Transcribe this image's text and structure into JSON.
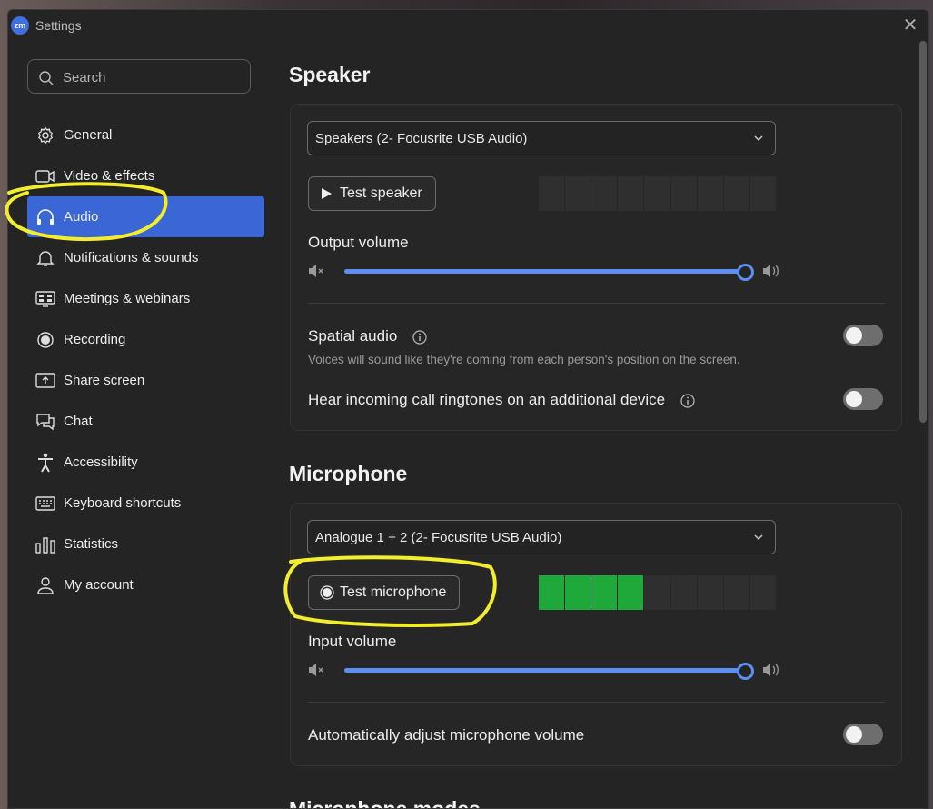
{
  "window": {
    "title": "Settings",
    "logo_text": "zm",
    "close_glyph": "✕"
  },
  "search": {
    "placeholder": "Search"
  },
  "sidebar": {
    "items": [
      {
        "label": "General",
        "icon": "gear-icon"
      },
      {
        "label": "Video & effects",
        "icon": "video-camera-icon"
      },
      {
        "label": "Audio",
        "icon": "headphones-icon",
        "active": true
      },
      {
        "label": "Notifications & sounds",
        "icon": "bell-icon"
      },
      {
        "label": "Meetings & webinars",
        "icon": "meetings-icon"
      },
      {
        "label": "Recording",
        "icon": "record-icon"
      },
      {
        "label": "Share screen",
        "icon": "share-screen-icon"
      },
      {
        "label": "Chat",
        "icon": "chat-icon"
      },
      {
        "label": "Accessibility",
        "icon": "accessibility-icon"
      },
      {
        "label": "Keyboard shortcuts",
        "icon": "keyboard-icon"
      },
      {
        "label": "Statistics",
        "icon": "statistics-icon"
      },
      {
        "label": "My account",
        "icon": "user-icon"
      }
    ]
  },
  "speaker": {
    "heading": "Speaker",
    "device": "Speakers (2- Focusrite USB Audio)",
    "test_button": "Test speaker",
    "meter_active_segments": 0,
    "meter_segments": 9,
    "output_volume_label": "Output volume",
    "output_volume": 1.0,
    "spatial_audio": {
      "label": "Spatial audio",
      "description": "Voices will sound like they're coming from each person's position on the screen.",
      "enabled": false
    },
    "ringtone": {
      "label": "Hear incoming call ringtones on an additional device",
      "enabled": false
    }
  },
  "microphone": {
    "heading": "Microphone",
    "device": "Analogue 1 + 2 (2- Focusrite USB Audio)",
    "test_button": "Test microphone",
    "meter_active_segments": 4,
    "meter_segments": 9,
    "input_volume_label": "Input volume",
    "input_volume": 1.0,
    "auto_adjust": {
      "label": "Automatically adjust microphone volume",
      "enabled": false
    }
  },
  "next_section": {
    "heading": "Microphone modes"
  },
  "colors": {
    "accent": "#3a66d6",
    "meter_on": "#1fa93a",
    "slider": "#5b8ff0",
    "annotation": "#f2ee2e"
  }
}
